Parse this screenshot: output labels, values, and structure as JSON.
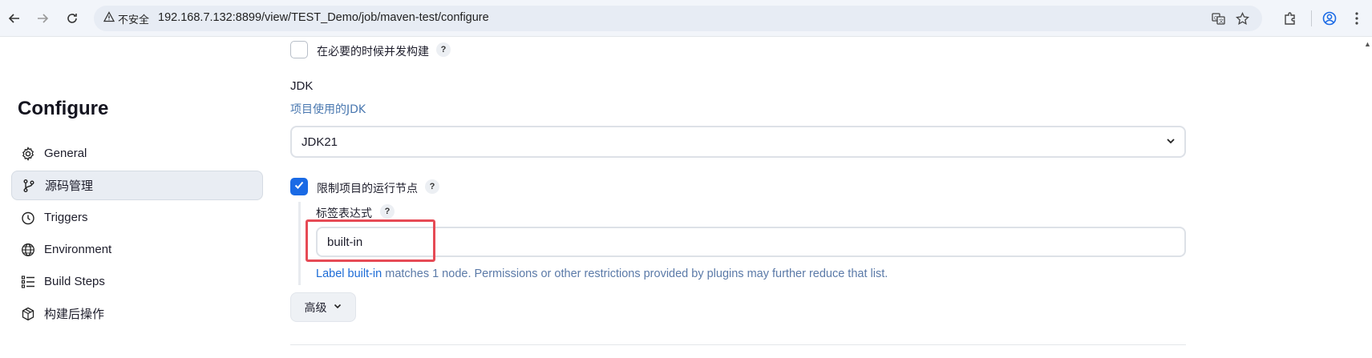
{
  "browser": {
    "security_label": "不安全",
    "url": "192.168.7.132:8899/view/TEST_Demo/job/maven-test/configure",
    "icons": [
      "back-icon",
      "forward-icon",
      "reload-icon",
      "warning-icon",
      "translate-icon",
      "star-icon",
      "extensions-icon",
      "profile-icon",
      "more-icon"
    ]
  },
  "sidebar": {
    "title": "Configure",
    "items": [
      {
        "label": "General",
        "icon": "gear-icon"
      },
      {
        "label": "源码管理",
        "icon": "branch-icon",
        "active": true
      },
      {
        "label": "Triggers",
        "icon": "clock-icon"
      },
      {
        "label": "Environment",
        "icon": "globe-icon"
      },
      {
        "label": "Build Steps",
        "icon": "list-icon"
      },
      {
        "label": "构建后操作",
        "icon": "package-icon"
      }
    ]
  },
  "form": {
    "concurrent": {
      "label": "在必要的时候并发构建",
      "checked": false,
      "help": "?"
    },
    "jdk": {
      "title": "JDK",
      "description": "项目使用的JDK",
      "selected": "JDK21"
    },
    "restrict": {
      "label": "限制项目的运行节点",
      "checked": true,
      "help": "?"
    },
    "label_expression": {
      "label": "标签表达式",
      "help": "?",
      "value": "built-in"
    },
    "match_note": {
      "link_text": "Label built-in",
      "rest": " matches 1 node. Permissions or other restrictions provided by plugins may further reduce that list."
    },
    "advanced_button": "高级"
  },
  "colors": {
    "accent": "#1a6ae5",
    "highlight_box": "#e64a55",
    "link": "#1c6bd6"
  }
}
